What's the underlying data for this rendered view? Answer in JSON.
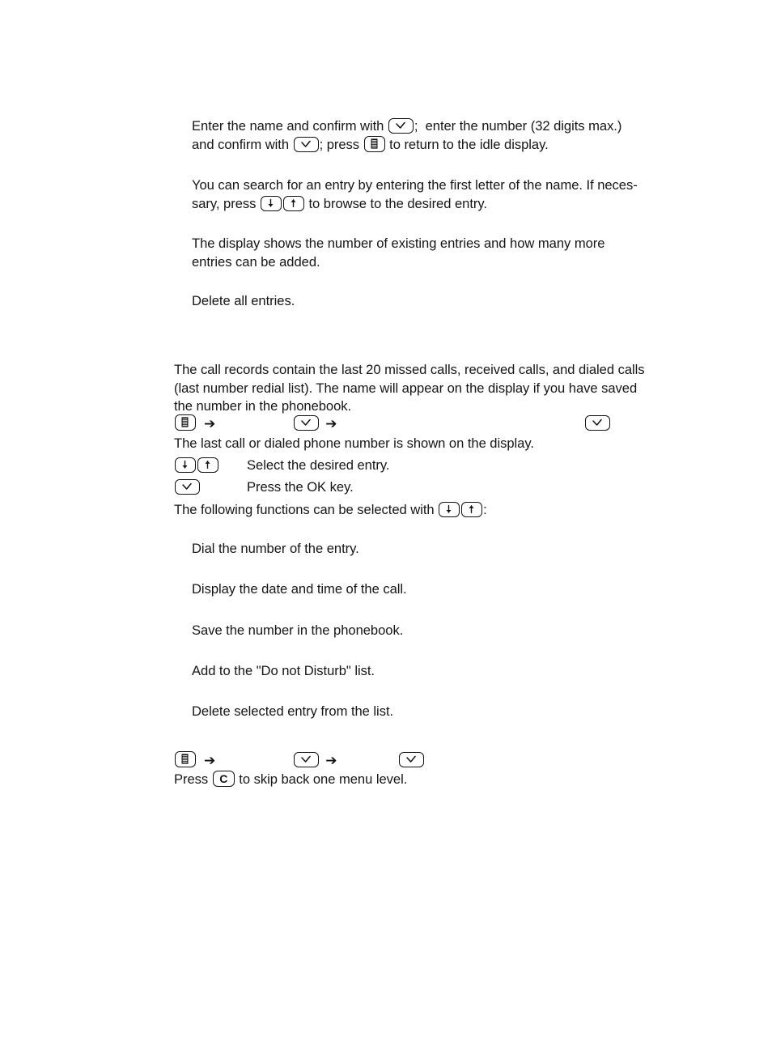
{
  "document": {
    "page_background": "#ffffff",
    "text_color": "#161616"
  },
  "icons": {
    "ok_key": "checkmark-key-icon",
    "menu_key": "menu-key-icon",
    "down_key": "arrow-down-key-icon",
    "up_key": "arrow-up-key-icon",
    "c_key": "c-key-icon",
    "nav_arrow": "right-arrow-icon",
    "c_key_label": "C",
    "nav_arrow_glyph": "➔"
  },
  "sections": {
    "phonebook": {
      "add_entry": {
        "text_1": "Enter the name and confirm with ",
        "text_2": ";  enter the number (32 digits max.)\nand confirm with ",
        "text_3": "; press ",
        "text_4": " to return to the idle display."
      },
      "search_entry": {
        "text_1": "You can search for an entry by entering the first letter of the name. If neces-\nsary, press ",
        "text_2": " to browse to the desired entry."
      },
      "status": {
        "text": "The display shows the number of existing entries and how many more\nentries can be added."
      },
      "delete_all": {
        "text": "Delete all entries."
      }
    },
    "call_records": {
      "intro": {
        "text": "The call records contain the last 20 missed calls, received calls, and dialed calls\n(last number redial list). The name will appear on the display if you have saved\nthe number in the phonebook."
      },
      "nav_line_1": {
        "keys": [
          "menu-key-icon",
          "right-arrow-icon",
          "checkmark-key-icon",
          "right-arrow-icon",
          "checkmark-key-icon"
        ]
      },
      "after_nav_1": {
        "text": "The last call or dialed phone number is shown on the display."
      },
      "step_select": {
        "label": "Select the desired entry."
      },
      "step_ok": {
        "label": "Press the OK key."
      },
      "functions_intro": {
        "text_1": "The following functions can be selected with ",
        "text_2": ":"
      },
      "functions": [
        "Dial the number of the entry.",
        "Display the date and time of the call.",
        "Save the number in the phonebook.",
        "Add to the \"Do not Disturb\" list.",
        "Delete selected entry from the list."
      ],
      "nav_line_2": {
        "keys": [
          "menu-key-icon",
          "right-arrow-icon",
          "checkmark-key-icon",
          "right-arrow-icon",
          "checkmark-key-icon"
        ]
      },
      "back_hint": {
        "text_1": "Press ",
        "text_2": " to skip back one menu level."
      }
    }
  }
}
